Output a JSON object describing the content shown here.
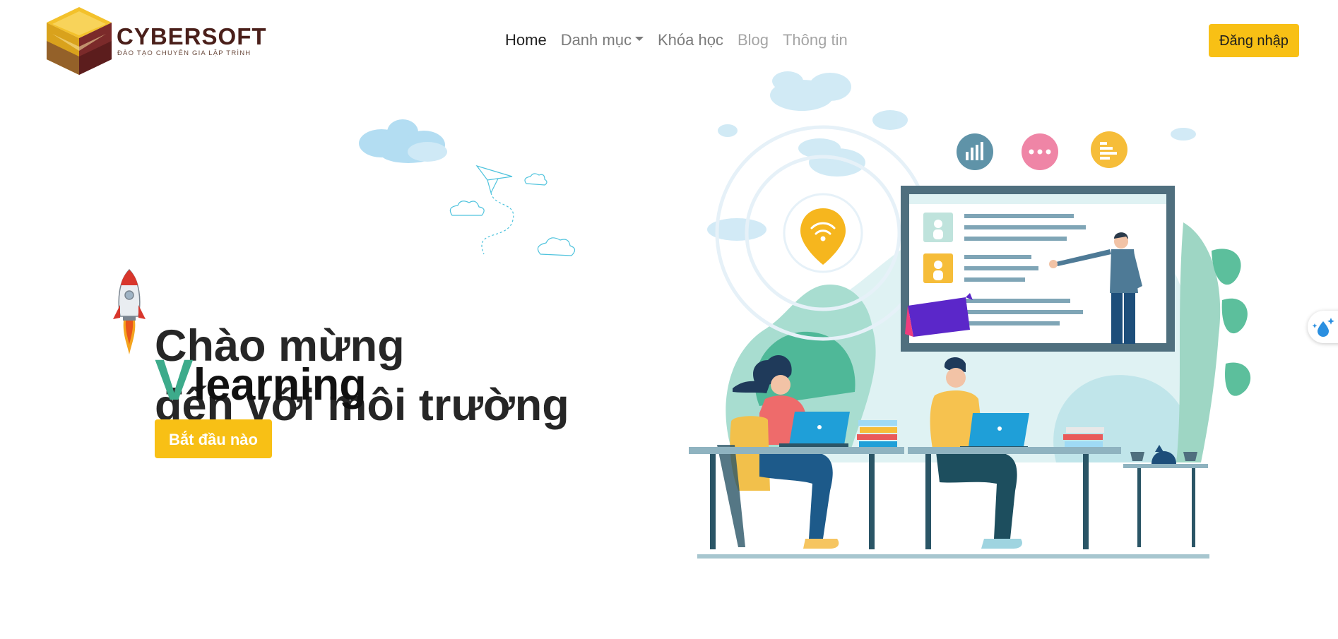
{
  "brand": {
    "name": "CYBERSOFT",
    "tagline": "ĐÀO TẠO CHUYÊN GIA LẬP TRÌNH",
    "logo_icon": "gold-cube-logo-icon"
  },
  "nav": {
    "items": [
      {
        "label": "Home",
        "state": "active"
      },
      {
        "label": "Danh mục",
        "state": "dropdown"
      },
      {
        "label": "Khóa học",
        "state": "normal"
      },
      {
        "label": "Blog",
        "state": "muted"
      },
      {
        "label": "Thông tin",
        "state": "muted"
      }
    ],
    "login_label": "Đăng nhập"
  },
  "hero": {
    "line1": "Chào mừng",
    "line2": "đến với môi trường",
    "brand_first": "V",
    "brand_rest": "learning",
    "cta_label": "Bắt đầu nào"
  },
  "colors": {
    "accent": "#f8c015",
    "brand_green": "#3dab8b",
    "text_dark": "#262626"
  },
  "icons": {
    "rocket": "rocket-icon",
    "widget": "water-drop-sparkle-icon"
  }
}
